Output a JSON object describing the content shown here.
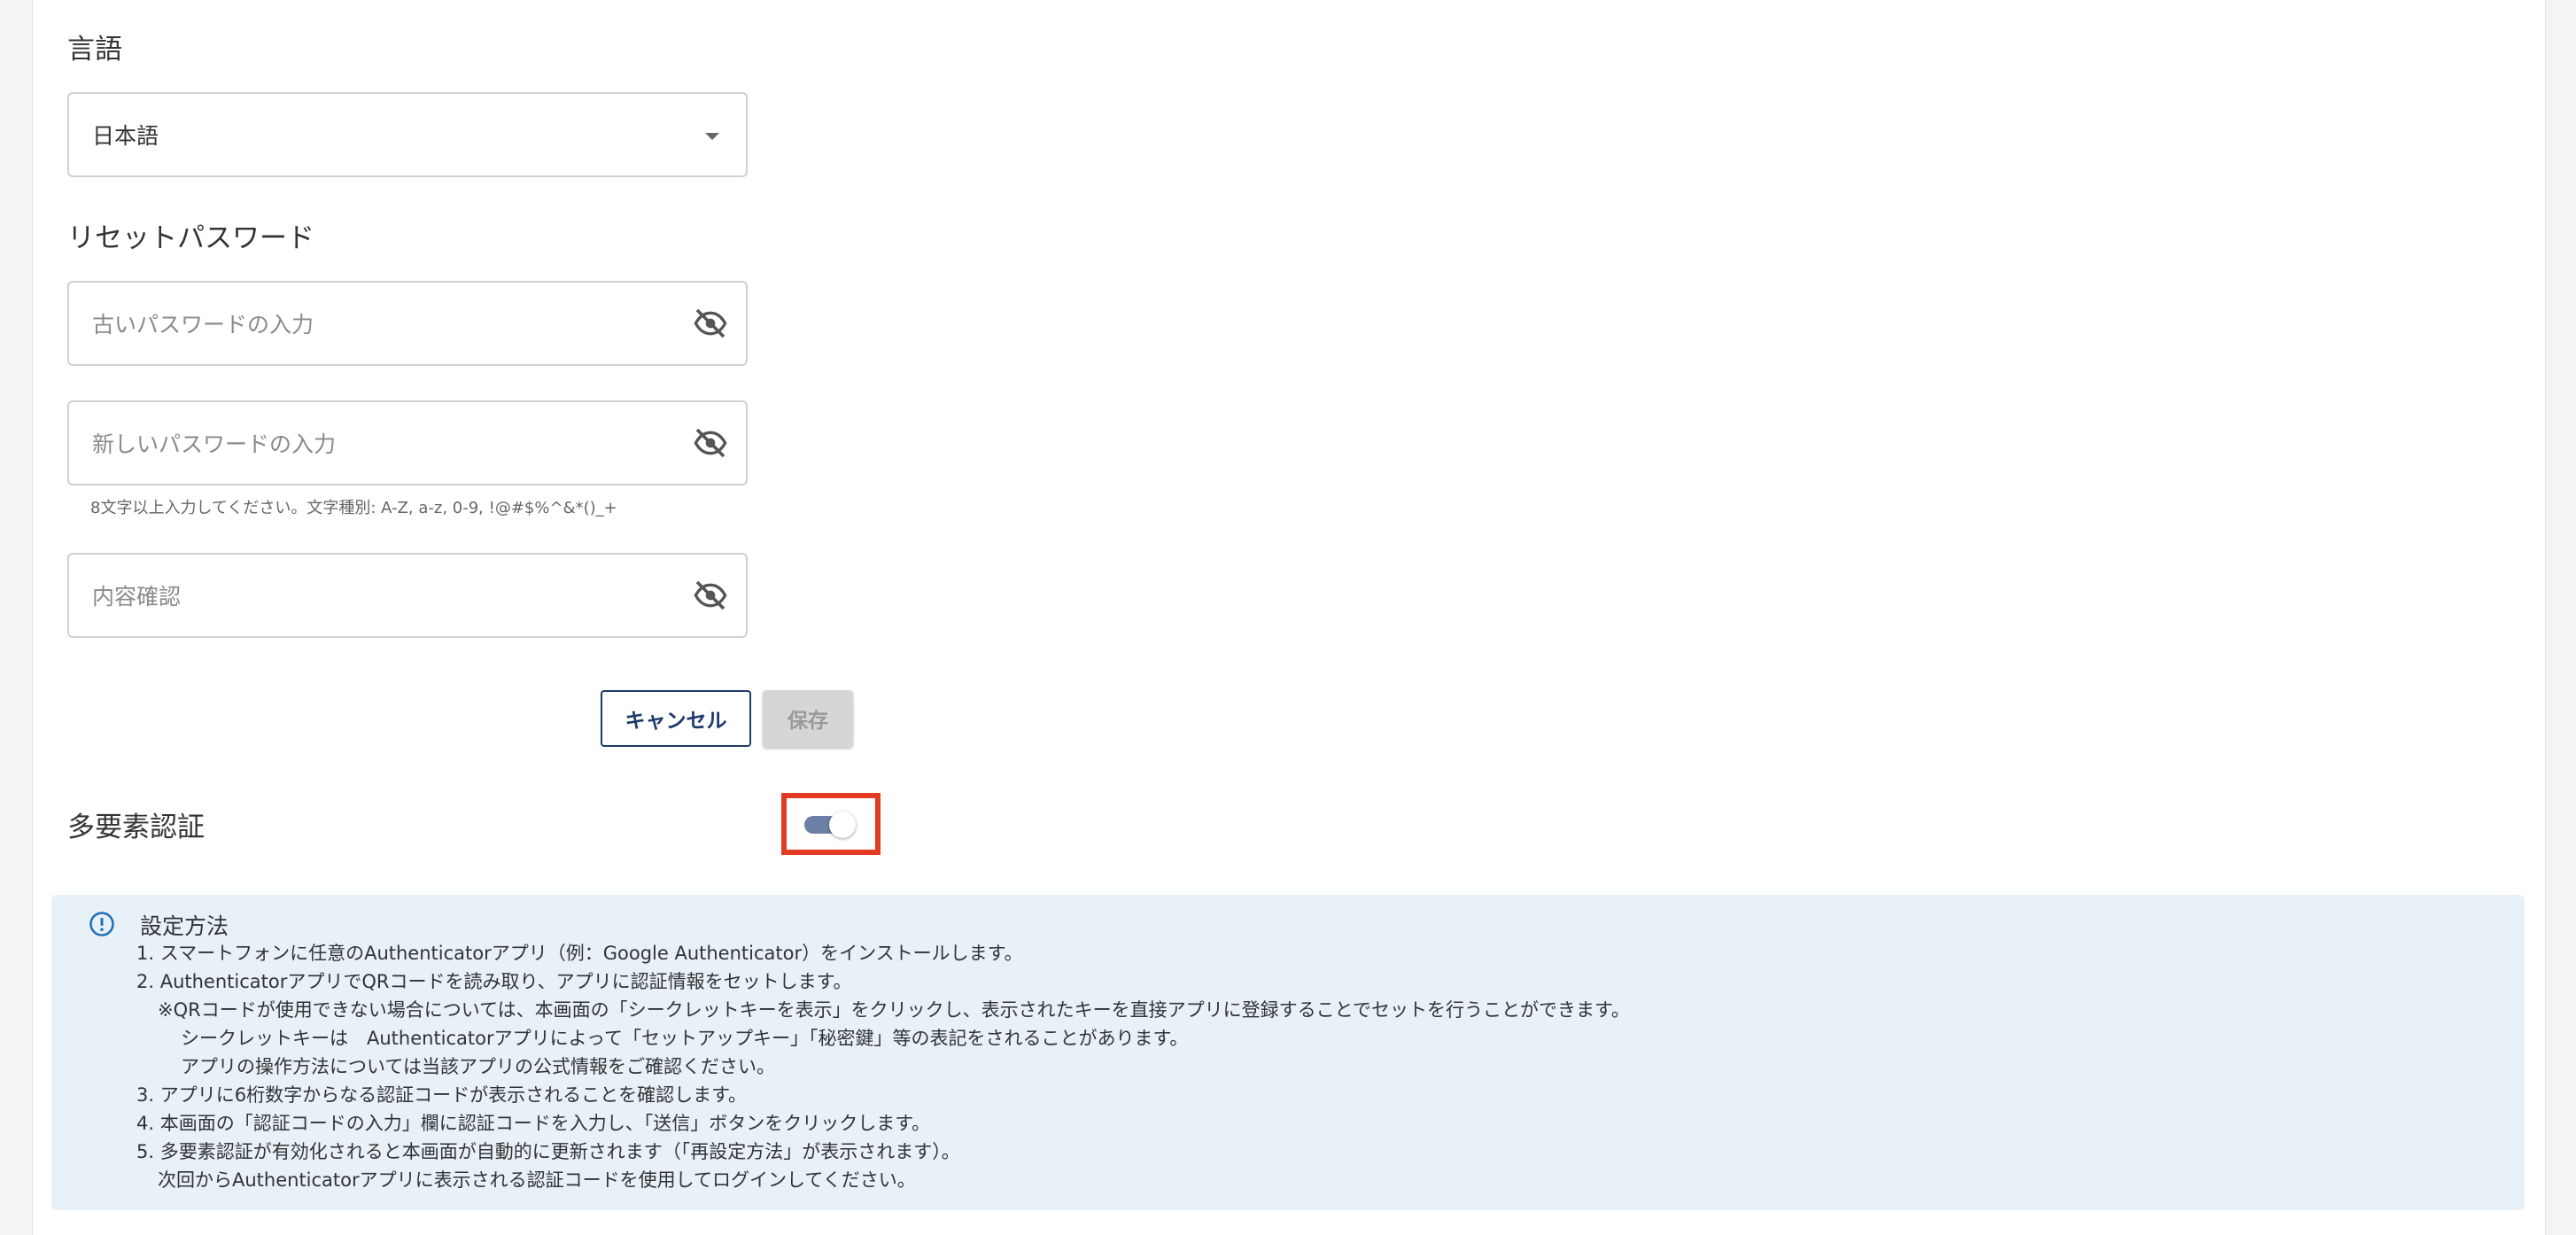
{
  "language": {
    "section_title": "言語",
    "selected": "日本語"
  },
  "reset_password": {
    "section_title": "リセットパスワード",
    "old_placeholder": "古いパスワードの入力",
    "new_placeholder": "新しいパスワードの入力",
    "helper": "8文字以上入力してください。文字種別: A-Z, a-z, 0-9, !@#$%^&*()_+",
    "confirm_placeholder": "内容確認",
    "cancel_label": "キャンセル",
    "save_label": "保存"
  },
  "mfa": {
    "section_title": "多要素認証",
    "enabled": true
  },
  "info": {
    "title": "設定方法",
    "lines": [
      "1. スマートフォンに任意のAuthenticatorアプリ（例：Google Authenticator）をインストールします。",
      "2. AuthenticatorアプリでQRコードを読み取り、アプリに認証情報をセットします。",
      "※QRコードが使用できない場合については、本画面の「シークレットキーを表示」をクリックし、表示されたキーを直接アプリに登録することでセットを行うことができます。",
      "シークレットキーは　Authenticatorアプリによって「セットアップキー」「秘密鍵」等の表記をされることがあります。",
      "アプリの操作方法については当該アプリの公式情報をご確認ください。",
      "3. アプリに6桁数字からなる認証コードが表示されることを確認します。",
      "4. 本画面の「認証コードの入力」欄に認証コードを入力し、「送信」ボタンをクリックします。",
      "5. 多要素認証が有効化されると本画面が自動的に更新されます（「再設定方法」が表示されます）。",
      "次回からAuthenticatorアプリに表示される認証コードを使用してログインしてください。"
    ]
  },
  "colors": {
    "accent": "#1f3a6b",
    "highlight": "#e23b22",
    "info_bg": "#e8f0f8",
    "toggle_track": "#6d7fa6"
  }
}
